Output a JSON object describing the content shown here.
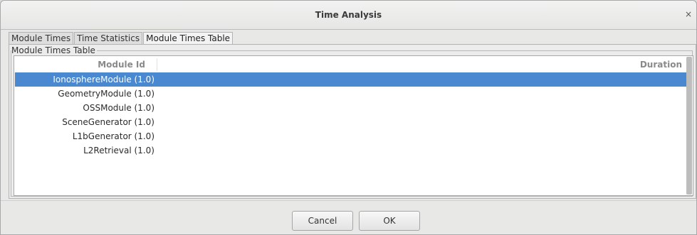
{
  "window": {
    "title": "Time Analysis",
    "close_glyph": "×"
  },
  "tabs": [
    {
      "label": "Module Times",
      "active": false
    },
    {
      "label": "Time Statistics",
      "active": false
    },
    {
      "label": "Module Times Table",
      "active": true
    }
  ],
  "group": {
    "title": "Module Times Table"
  },
  "table": {
    "columns": [
      "Module Id",
      "Duration"
    ],
    "rows": [
      {
        "module_id": "IonosphereModule (1.0)",
        "duration": "",
        "selected": true
      },
      {
        "module_id": "GeometryModule (1.0)",
        "duration": "",
        "selected": false
      },
      {
        "module_id": "OSSModule (1.0)",
        "duration": "",
        "selected": false
      },
      {
        "module_id": "SceneGenerator (1.0)",
        "duration": "",
        "selected": false
      },
      {
        "module_id": "L1bGenerator (1.0)",
        "duration": "",
        "selected": false
      },
      {
        "module_id": "L2Retrieval (1.0)",
        "duration": "",
        "selected": false
      }
    ]
  },
  "buttons": {
    "cancel_label": "Cancel",
    "ok_label": "OK"
  },
  "colors": {
    "selection": "#4a88cf"
  }
}
